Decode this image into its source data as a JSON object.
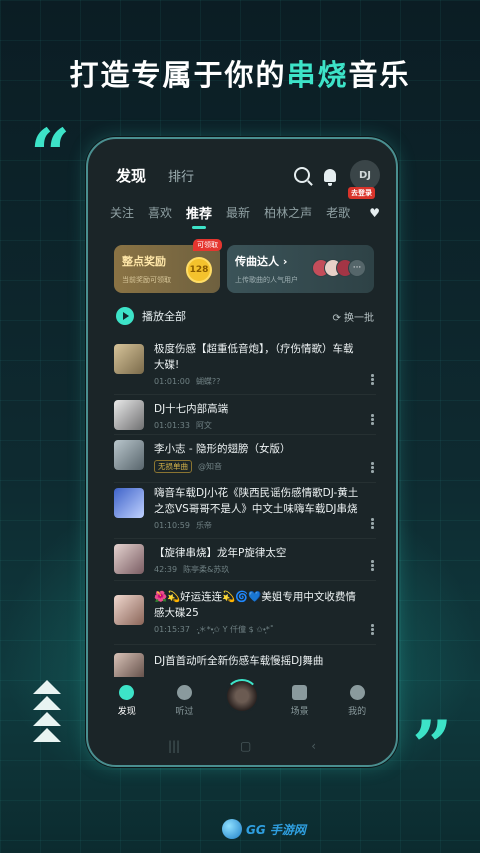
{
  "promo": {
    "headline_pre": "打造专属于你的",
    "headline_highlight": "串烧",
    "headline_post": "音乐"
  },
  "colors": {
    "accent": "#3de3c8",
    "background": "#0e2a30",
    "phone_bg": "#1b2528"
  },
  "header": {
    "title_discover": "发现",
    "title_rank": "排行",
    "avatar_text": "DJ",
    "login_badge": "去登录"
  },
  "tabs": [
    {
      "label": "关注"
    },
    {
      "label": "喜欢"
    },
    {
      "label": "推荐"
    },
    {
      "label": "最新"
    },
    {
      "label": "柏林之声"
    },
    {
      "label": "老歌"
    }
  ],
  "active_tab": "推荐",
  "cards": {
    "reward": {
      "title": "整点奖励",
      "subtitle": "当前奖励可领取",
      "coin": "128",
      "tag": "可领取"
    },
    "talent": {
      "title": "传曲达人 ›",
      "subtitle": "上传歌曲的人气用户"
    }
  },
  "playlist": {
    "play_all": "播放全部",
    "refresh": "⟳ 换一批"
  },
  "songs": [
    {
      "title": "极度伤感【超重低音炮】，（疗伤情歌）车载大碟!",
      "time": "01:01:00",
      "artist": "蝴蝶??",
      "tag": ""
    },
    {
      "title": "DJ十七内部高端",
      "time": "01:01:33",
      "artist": "阿文",
      "tag": ""
    },
    {
      "title": "李小志 - 隐形的翅膀（女版）",
      "time": "",
      "artist": "@知音",
      "tag": "无损单曲"
    },
    {
      "title": "嗨音车载DJ小花《陕西民谣伤感情歌DJ-黄土之恋VS哥哥不是人》中文土味嗨车载DJ串烧",
      "time": "01:10:59",
      "artist": "乐帝",
      "tag": ""
    },
    {
      "title": "【旋律串烧】龙年P旋律太空",
      "time": "42:39",
      "artist": "陈亭柔&苏玖",
      "tag": ""
    },
    {
      "title": "🌺💫好运连连💫🌀💙美姐专用中文收费情感大碟25",
      "time": "01:15:37",
      "artist": "·̩̩̥͙＊*•̩̩͙✩ Y 仟僮 $ ✩•̩̩͙*˚",
      "tag": ""
    },
    {
      "title": "DJ首首动听全新伤感车载慢摇DJ舞曲",
      "time": "",
      "artist": "",
      "tag": ""
    }
  ],
  "bottom_nav": [
    {
      "label": "发现",
      "icon": "disc-icon"
    },
    {
      "label": "听过",
      "icon": "person-icon"
    },
    {
      "label": "",
      "icon": "now-playing-disc"
    },
    {
      "label": "场景",
      "icon": "chart-icon"
    },
    {
      "label": "我的",
      "icon": "user-icon"
    }
  ],
  "watermark": "GG 手游网"
}
